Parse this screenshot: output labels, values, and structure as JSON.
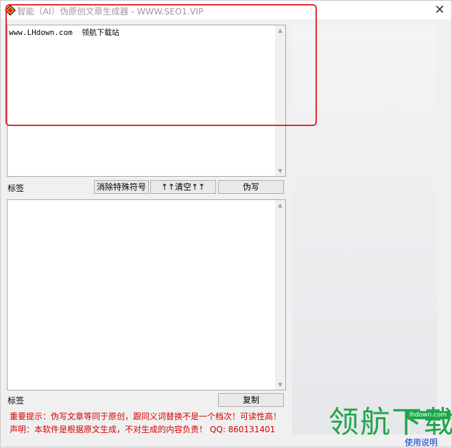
{
  "window": {
    "title": "智能（AI）伪原创文章生成器 - WWW.SEO1.VIP",
    "close_glyph": "✕",
    "icon_name": "app-diamond-icon"
  },
  "input_box": {
    "text": "www.LHdown.com  领航下载站"
  },
  "toolbar": {
    "tag_label": "标签",
    "remove_special_label": "消除特殊符号",
    "clear_label": "↑↑清空↑↑",
    "rewrite_label": "伪写"
  },
  "output_box": {
    "text": ""
  },
  "bottom_bar": {
    "tag_label": "标签",
    "copy_label": "复制"
  },
  "notices": {
    "tip": "重要提示：伪写文章等同于原创，跟同义词替换不是一个档次！可读性高！",
    "statement": "声明：本软件是根据原文生成，不对生成的内容负责！  QQ: 860131401"
  },
  "watermark": {
    "brand": "领航下载",
    "site": "lhdown.com"
  },
  "help": {
    "label": "使用说明"
  },
  "colors": {
    "notice_red": "#d40000",
    "highlight_red": "#e0272b",
    "watermark_green": "#1ea64a",
    "link_blue": "#0033cc"
  }
}
